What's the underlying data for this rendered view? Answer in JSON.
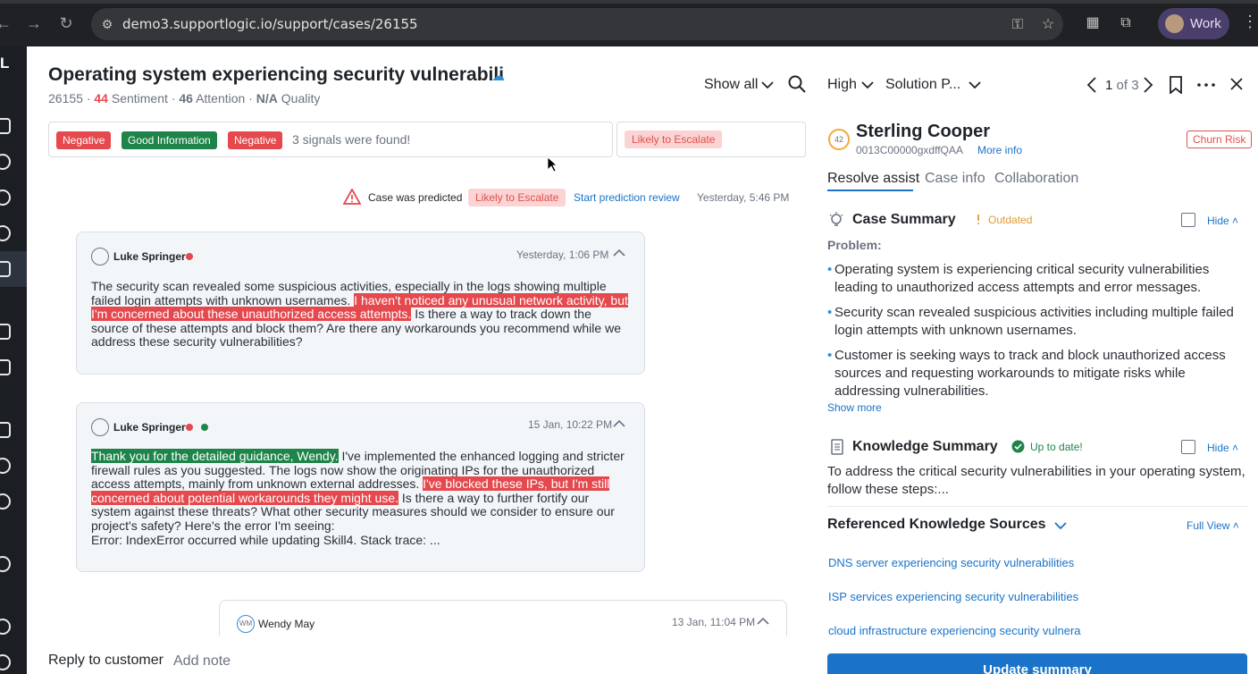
{
  "browser": {
    "url": "demo3.supportlogic.io/support/cases/26155",
    "profile_label": "Work"
  },
  "rail": {
    "logo": "L"
  },
  "case": {
    "title": "Operating system experiencing security vulnerabili",
    "id": "26155",
    "sentiment_value": "44",
    "sentiment_label": "Sentiment",
    "attention_value": "46",
    "attention_label": "Attention",
    "quality_value": "N/A",
    "quality_label": "Quality",
    "separator": "·"
  },
  "toolbar": {
    "show_all_label": "Show all"
  },
  "signals": {
    "badges": [
      "Negative",
      "Good Information",
      "Negative"
    ],
    "summary": "3 signals were found!",
    "escalation_badge": "Likely to Escalate"
  },
  "prediction": {
    "text": "Case was predicted",
    "badge": "Likely to Escalate",
    "link": "Start prediction review",
    "time": "Yesterday, 5:46 PM"
  },
  "messages": [
    {
      "author": "Luke Springer",
      "time": "Yesterday, 1:06 PM",
      "body_pre": "The security scan revealed some suspicious activities, especially in the logs showing multiple failed login attempts with unknown usernames. ",
      "body_hl": "I haven't noticed any unusual network activity, but I'm concerned about these unauthorized access attempts.",
      "body_post": " Is there a way to track down the source of these attempts and block them? Are there any workarounds you recommend while we address these security vulnerabilities?"
    },
    {
      "author": "Luke Springer",
      "time": "15 Jan, 10:22 PM",
      "body_hl_green": "Thank you for the detailed guidance, Wendy.",
      "body_mid": " I've implemented the enhanced logging and stricter firewall rules as you suggested. The logs now show the originating IPs for the unauthorized access attempts, mainly from unknown external addresses. ",
      "body_hl_red": "I've blocked these IPs, but I'm still concerned about potential workarounds they might use.",
      "body_post": " Is there a way to further fortify our system against these threats? What other security measures should we consider to ensure our project's safety? Here's the error I'm seeing:",
      "body_error": "Error: IndexError occurred while updating Skill4. Stack trace: ..."
    },
    {
      "author": "Wendy May",
      "avatar_initials": "WM",
      "time": "13 Jan, 11:04 PM"
    }
  ],
  "composer": {
    "reply_tab": "Reply to customer",
    "note_tab": "Add note"
  },
  "panel": {
    "priority": "High",
    "solution": "Solution P...",
    "pager_current": "1",
    "pager_total": "of 3",
    "score": "42",
    "company": "Sterling Cooper",
    "account_id": "0013C00000gxdffQAA",
    "more_info": "More info",
    "churn_badge": "Churn Risk",
    "tabs": [
      "Resolve assist",
      "Case info",
      "Collaboration"
    ],
    "case_summary": {
      "title": "Case Summary",
      "status": "Outdated",
      "hide": "Hide",
      "problem_label": "Problem:",
      "bullets": [
        "Operating system is experiencing critical security vulnerabilities leading to unauthorized access attempts and error messages.",
        "Security scan revealed suspicious activities including multiple failed login attempts with unknown usernames.",
        "Customer is seeking ways to track and block unauthorized access sources and requesting workarounds to mitigate risks while addressing vulnerabilities."
      ],
      "show_more": "Show more"
    },
    "knowledge_summary": {
      "title": "Knowledge Summary",
      "status": "Up to date!",
      "hide": "Hide",
      "text": "To address the critical security vulnerabilities in your operating system, follow these steps:..."
    },
    "references": {
      "title": "Referenced Knowledge Sources",
      "full_view": "Full View",
      "links": [
        "DNS server experiencing security vulnerabilities",
        "ISP services experiencing security vulnerabilities",
        "cloud infrastructure experiencing security vulnera"
      ]
    },
    "update_button": "Update summary"
  },
  "colors": {
    "accent": "#1a73c8",
    "negative": "#e5484d",
    "positive": "#1e8449",
    "warning": "#e09b30"
  }
}
